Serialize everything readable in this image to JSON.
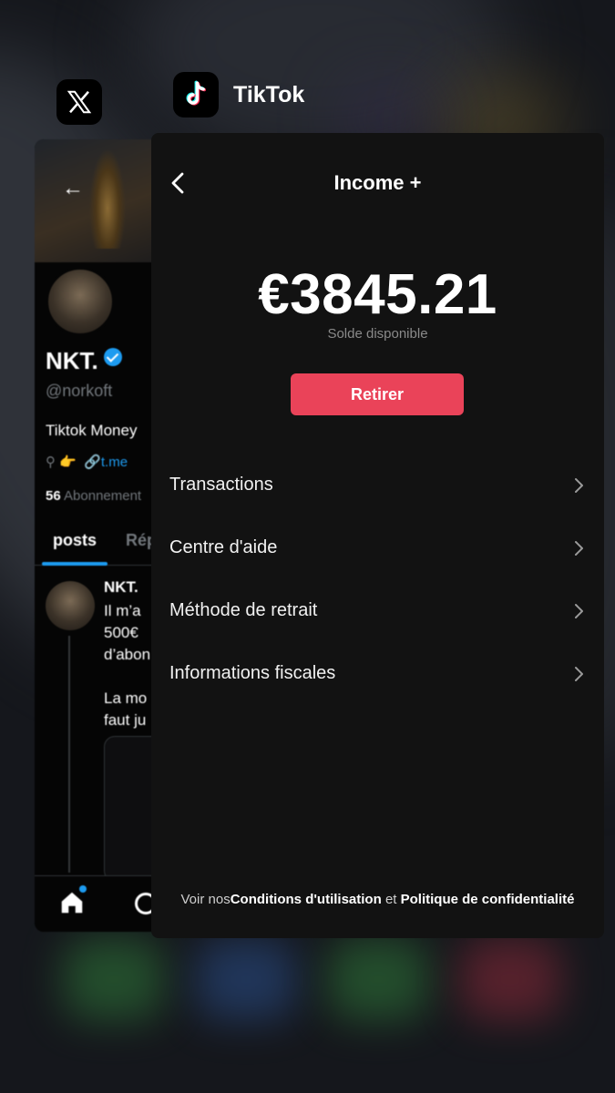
{
  "switcher": {
    "tiktok_label": "TikTok"
  },
  "x_app": {
    "name": "NKT.",
    "handle": "@norkoft",
    "bio": "Tiktok Money",
    "location_emoji": "👉",
    "link": "t.me",
    "following_count": "56",
    "following_label": "Abonnement",
    "tabs": [
      "posts",
      "Rép"
    ],
    "post": {
      "author": "NKT.",
      "text": "Il m’a\n500€\nd’abon\n\nLa mo\nfaut ju"
    }
  },
  "tiktok": {
    "title": "Income +",
    "balance": "€3845.21",
    "balance_label": "Solde disponible",
    "withdraw_button": "Retirer",
    "menu": [
      {
        "label": "Transactions"
      },
      {
        "label": "Centre d'aide"
      },
      {
        "label": "Méthode de retrait"
      },
      {
        "label": "Informations fiscales"
      }
    ],
    "footer": {
      "prefix": "Voir nos",
      "terms": "Conditions d'utilisation",
      "and": "et",
      "privacy": "Politique de confidentialité"
    }
  },
  "colors": {
    "accent": "#ea4359",
    "x_blue": "#1d9bf0",
    "card_bg": "#121212"
  },
  "icons": [
    "x-logo-icon",
    "tiktok-logo-icon",
    "back-arrow-icon",
    "chevron-right-icon",
    "verified-icon",
    "home-icon",
    "search-icon",
    "location-pin-icon",
    "link-icon"
  ]
}
